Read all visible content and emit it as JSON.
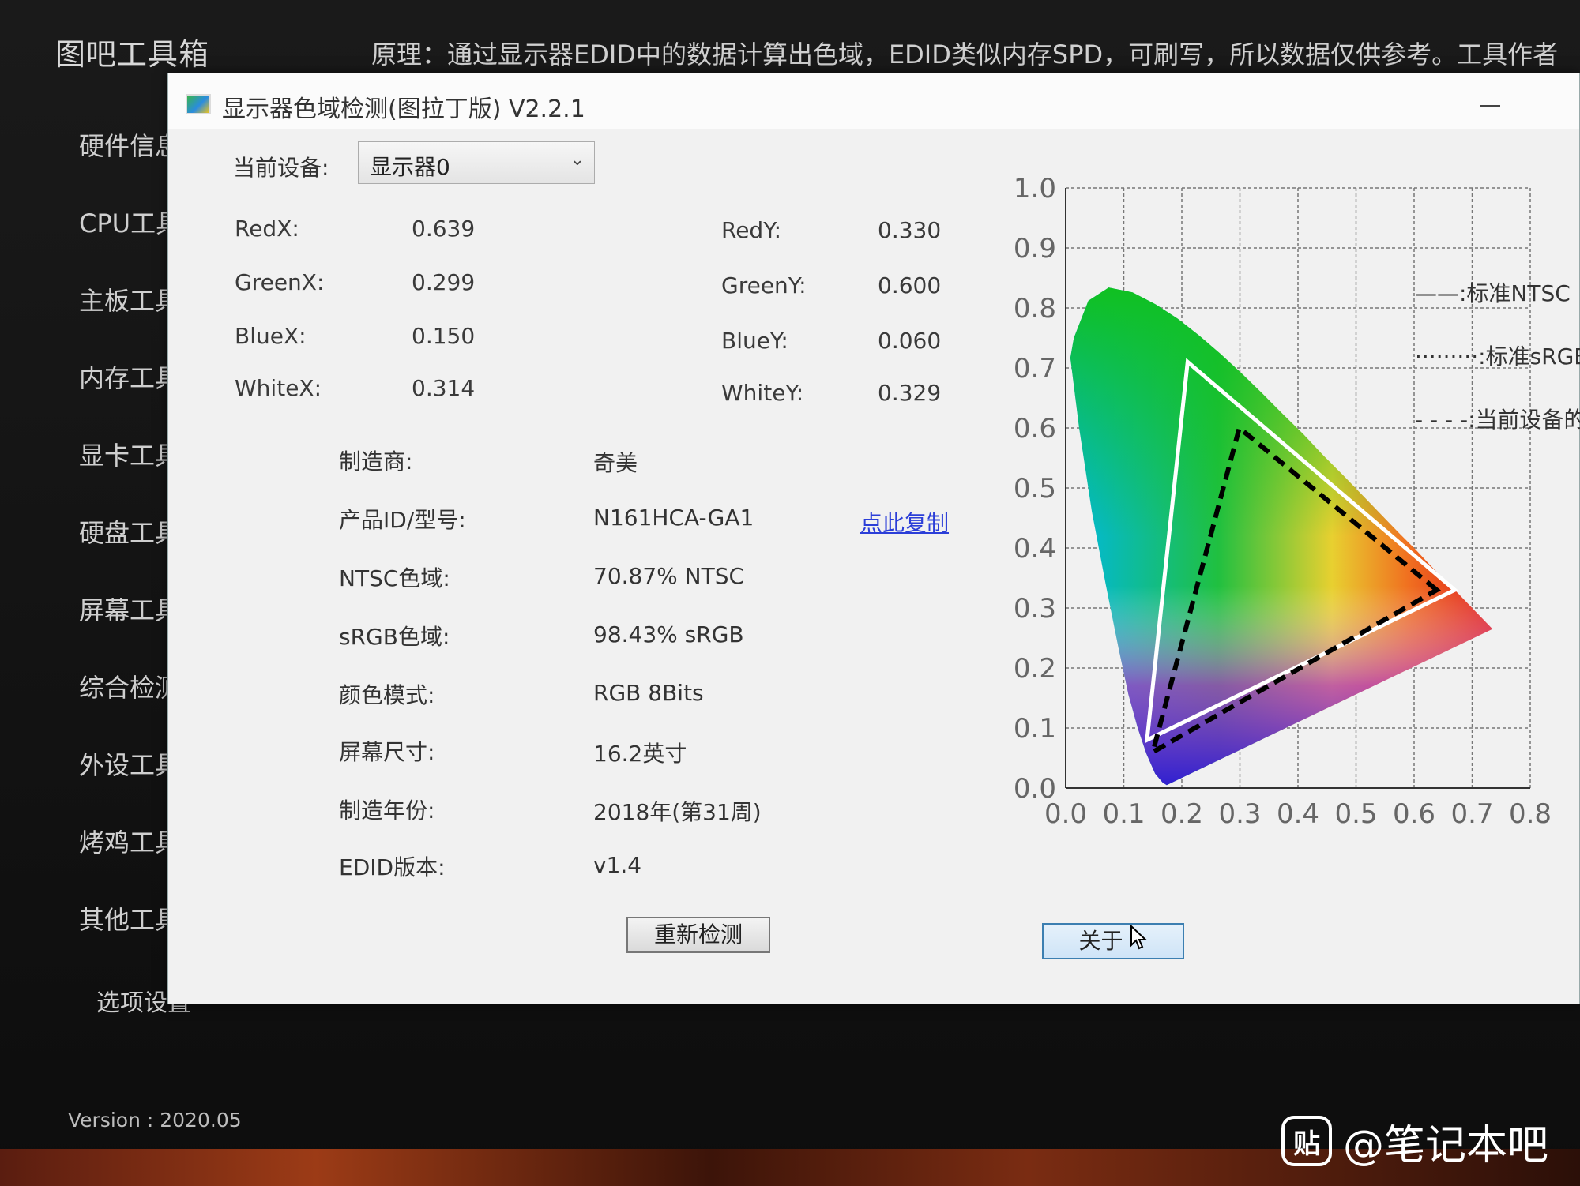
{
  "background_app": {
    "title": "图吧工具箱",
    "notice": "原理：通过显示器EDID中的数据计算出色域，EDID类似内存SPD，可刷写，所以数据仅供参考。工具作者",
    "menu": [
      "硬件信息",
      "CPU工具",
      "主板工具",
      "内存工具",
      "显卡工具",
      "硬盘工具",
      "屏幕工具",
      "综合检测",
      "外设工具",
      "烤鸡工具",
      "其他工具"
    ],
    "settings": "选项设置",
    "version": "Version : 2020.05"
  },
  "dialog": {
    "title": "显示器色域检测(图拉丁版) V2.2.1",
    "device_label": "当前设备:",
    "device_value": "显示器0",
    "coords": {
      "red_x_label": "RedX:",
      "red_x": "0.639",
      "red_y_label": "RedY:",
      "red_y": "0.330",
      "green_x_label": "GreenX:",
      "green_x": "0.299",
      "green_y_label": "GreenY:",
      "green_y": "0.600",
      "blue_x_label": "BlueX:",
      "blue_x": "0.150",
      "blue_y_label": "BlueY:",
      "blue_y": "0.060",
      "white_x_label": "WhiteX:",
      "white_x": "0.314",
      "white_y_label": "WhiteY:",
      "white_y": "0.329"
    },
    "info": [
      {
        "label": "制造商:",
        "value": "奇美"
      },
      {
        "label": "产品ID/型号:",
        "value": "N161HCA-GA1"
      },
      {
        "label": "NTSC色域:",
        "value": "70.87% NTSC"
      },
      {
        "label": "sRGB色域:",
        "value": "98.43% sRGB"
      },
      {
        "label": "颜色模式:",
        "value": "RGB 8Bits"
      },
      {
        "label": "屏幕尺寸:",
        "value": "16.2英寸"
      },
      {
        "label": "制造年份:",
        "value": "2018年(第31周)"
      },
      {
        "label": "EDID版本:",
        "value": "v1.4"
      }
    ],
    "copy_link": "点此复制",
    "redetect_button": "重新检测",
    "about_button": "关于"
  },
  "chart_data": {
    "type": "scatter",
    "title": "",
    "xlabel": "",
    "ylabel": "",
    "xlim": [
      0.0,
      0.8
    ],
    "ylim": [
      0.0,
      1.0
    ],
    "x_ticks": [
      "0.0",
      "0.1",
      "0.2",
      "0.3",
      "0.4",
      "0.5",
      "0.6",
      "0.7",
      "0.8"
    ],
    "y_ticks": [
      "0.0",
      "0.1",
      "0.2",
      "0.3",
      "0.4",
      "0.5",
      "0.6",
      "0.7",
      "0.8",
      "0.9",
      "1.0"
    ],
    "grid": true,
    "legend_position": "top-right",
    "legend": [
      "——:标准NTSC",
      "·········:标准sRGB",
      "- - - -:当前设备的"
    ],
    "spectral_locus": [
      [
        0.174,
        0.005
      ],
      [
        0.167,
        0.009
      ],
      [
        0.154,
        0.024
      ],
      [
        0.139,
        0.057
      ],
      [
        0.124,
        0.1
      ],
      [
        0.108,
        0.156
      ],
      [
        0.091,
        0.233
      ],
      [
        0.069,
        0.339
      ],
      [
        0.045,
        0.461
      ],
      [
        0.023,
        0.601
      ],
      [
        0.008,
        0.717
      ],
      [
        0.014,
        0.75
      ],
      [
        0.039,
        0.812
      ],
      [
        0.074,
        0.834
      ],
      [
        0.115,
        0.826
      ],
      [
        0.155,
        0.806
      ],
      [
        0.193,
        0.782
      ],
      [
        0.23,
        0.754
      ],
      [
        0.266,
        0.724
      ],
      [
        0.302,
        0.692
      ],
      [
        0.337,
        0.659
      ],
      [
        0.373,
        0.624
      ],
      [
        0.409,
        0.59
      ],
      [
        0.444,
        0.554
      ],
      [
        0.479,
        0.52
      ],
      [
        0.512,
        0.487
      ],
      [
        0.544,
        0.455
      ],
      [
        0.575,
        0.424
      ],
      [
        0.603,
        0.397
      ],
      [
        0.627,
        0.372
      ],
      [
        0.648,
        0.351
      ],
      [
        0.666,
        0.334
      ],
      [
        0.68,
        0.32
      ],
      [
        0.691,
        0.309
      ],
      [
        0.701,
        0.299
      ],
      [
        0.735,
        0.265
      ]
    ],
    "series": [
      {
        "name": "标准NTSC",
        "style": "solid",
        "color": "#ffffff",
        "points": [
          [
            0.67,
            0.33
          ],
          [
            0.21,
            0.71
          ],
          [
            0.14,
            0.08
          ]
        ]
      },
      {
        "name": "当前设备的",
        "style": "dashed",
        "color": "#000000",
        "points": [
          [
            0.639,
            0.33
          ],
          [
            0.299,
            0.6
          ],
          [
            0.15,
            0.06
          ]
        ]
      }
    ]
  }
}
